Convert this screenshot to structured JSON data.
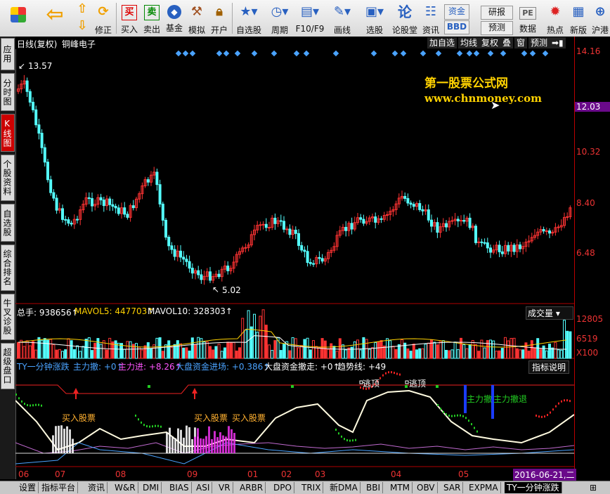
{
  "toolbar": {
    "items": [
      {
        "label": "",
        "icon": "grid-icon"
      },
      {
        "label": "",
        "icon": "back-arrow-icon"
      },
      {
        "label": "",
        "icon": "up-arrow-icon"
      },
      {
        "label": "",
        "icon": "down-arrow-icon"
      },
      {
        "label": "修正",
        "icon": "refresh-icon"
      },
      {
        "label": "买入",
        "icon": "buy-icon",
        "glyph": "买"
      },
      {
        "label": "卖出",
        "icon": "sell-icon",
        "glyph": "卖"
      },
      {
        "label": "基金",
        "icon": "fund-icon"
      },
      {
        "label": "模拟",
        "icon": "hammer-icon"
      },
      {
        "label": "开户",
        "icon": "lock-icon"
      },
      {
        "label": "自选股",
        "icon": "star-icon"
      },
      {
        "label": "周期",
        "icon": "clock-icon"
      },
      {
        "label": "F10/F9",
        "icon": "f10-icon"
      },
      {
        "label": "画线",
        "icon": "pencil-icon"
      },
      {
        "label": "选股",
        "icon": "select-icon"
      },
      {
        "label": "论股堂",
        "icon": "forum-icon",
        "glyph": "论"
      },
      {
        "label": "资讯",
        "icon": "news-icon"
      },
      {
        "label": "数据",
        "icon": "pe-icon",
        "glyph": "PE"
      },
      {
        "label": "热点",
        "icon": "hot-icon"
      },
      {
        "label": "新版",
        "icon": "newversion-icon"
      },
      {
        "label": "沪港",
        "icon": "hk-icon"
      }
    ],
    "zijin": "资金",
    "bbd": "BBD",
    "yanbao": "研报",
    "yuce": "预测"
  },
  "left_tabs": [
    "应用",
    "分时图",
    "K线图",
    "个股资料",
    "自选股",
    "综合排名",
    "牛叉诊股",
    "超级盘口"
  ],
  "header": {
    "period": "日线(复权)",
    "stock_name": "铜峰电子",
    "buttons": [
      "加自选",
      "均线",
      "复权",
      "叠",
      "窗",
      "预测"
    ]
  },
  "watermark": {
    "line1": "第一股票公式网",
    "line2": "www.chnmoney.com"
  },
  "price_axis": [
    "14.16",
    "12.03",
    "10.32",
    "8.40",
    "6.48"
  ],
  "current_price": "12.03",
  "annotations": {
    "high": "13.57",
    "low": "5.02"
  },
  "volume": {
    "label": "总手: 938656↑",
    "mavol5": "MAVOL5: 447703↑",
    "mavol10": "MAVOL10: 328303↑",
    "selector": "成交量",
    "axis": [
      "12805",
      "6519",
      "X100"
    ]
  },
  "indicator": {
    "name": "TY一分钟涨跌",
    "main_out": "主力撤: +0↑",
    "main_in": "主力进: +8.26↑",
    "big_in": "大盘资金进场: +0.386↑",
    "big_out": "大盘资金撤走: +0↑",
    "trend": "趋势线: +49",
    "help": "指标说明",
    "labels": {
      "buy1": "买入股票",
      "buy2": "买入股票",
      "buy3": "买入股票",
      "escape1": "逃顶",
      "escape2": "逃顶",
      "mainout": "主力撤",
      "mainret": "主力撤退"
    }
  },
  "time_axis": [
    "06",
    "07",
    "08",
    "09",
    "01",
    "02",
    "03",
    "04",
    "05"
  ],
  "date_box": "2016-06-21,二",
  "bottom_tabs": [
    "设置",
    "指标平台",
    "资讯",
    "W&R",
    "DMI",
    "BIAS",
    "ASI",
    "VR",
    "ARBR",
    "DPO",
    "TRIX",
    "新DMA",
    "BBI",
    "MTM",
    "OBV",
    "SAR",
    "EXPMA",
    "TY一分钟涨跌"
  ],
  "colors": {
    "up": "#ff3333",
    "down": "#54ffff",
    "accent": "#ffd200",
    "frame": "#b00000"
  }
}
